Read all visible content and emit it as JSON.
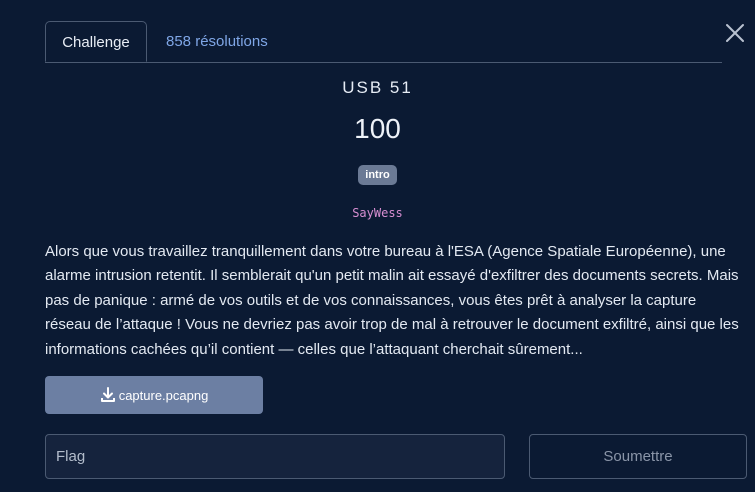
{
  "tabs": [
    {
      "label": "Challenge",
      "active": true
    },
    {
      "label": "858 résolutions",
      "active": false
    }
  ],
  "close_icon": "close-icon",
  "challenge": {
    "name": "USB 51",
    "points": "100",
    "tag": "intro",
    "author": "SayWess",
    "description": "Alors que vous travaillez tranquillement dans votre bureau à l'ESA (Agence Spatiale Européenne), une alarme intrusion retentit. Il semblerait qu'un petit malin ait essayé d'exfiltrer des documents secrets. Mais pas de panique : armé de vos outils et de vos connaissances, vous êtes prêt à analyser la capture réseau de l’attaque ! Vous ne devriez pas avoir trop de mal à retrouver le document exfiltré, ainsi que les informations cachées qu’il contient — celles que l’attaquant cherchait sûrement..."
  },
  "download": {
    "label": "capture.pcapng",
    "icon": "download-icon"
  },
  "flag_form": {
    "placeholder": "Flag",
    "value": "",
    "submit_label": "Soumettre"
  },
  "colors": {
    "background": "#0b1a33",
    "tab_link": "#7fa6e6",
    "badge": "#6b7a95",
    "author": "#d88fd2",
    "download_button": "#6c7fa3"
  }
}
